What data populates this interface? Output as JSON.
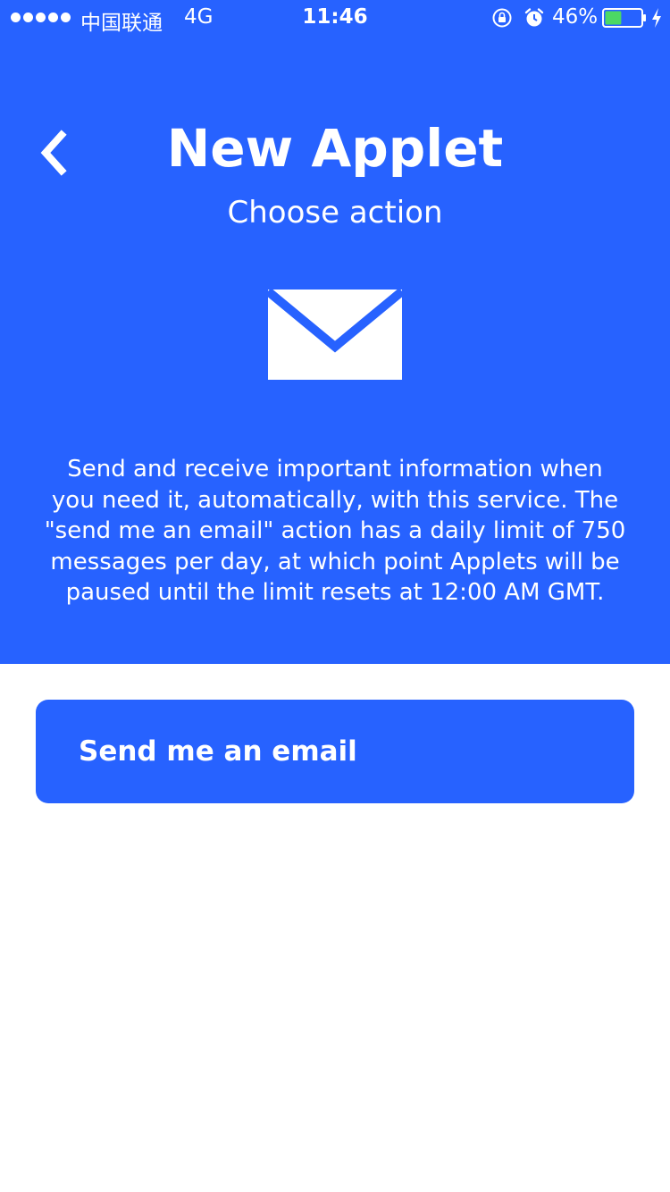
{
  "status_bar": {
    "carrier": "中国联通",
    "network": "4G",
    "time": "11:46",
    "battery": "46%",
    "battery_level": 0.46,
    "icons": [
      "orientation-lock-icon",
      "alarm-icon",
      "battery-icon",
      "charging-icon"
    ]
  },
  "header": {
    "title": "New Applet",
    "subtitle": "Choose action",
    "service_icon": "mail-icon",
    "description": "Send and receive important information when you need it, automatically, with this service. The \"send me an email\" action has a daily limit of 750 messages per day, at which point Applets will be paused until the limit resets at 12:00 AM GMT."
  },
  "actions": [
    {
      "label": "Send me an email"
    }
  ],
  "colors": {
    "brand_blue": "#2762ff",
    "text_on_brand": "#ffffff",
    "background": "#ffffff",
    "battery_fill": "#4cd964"
  }
}
